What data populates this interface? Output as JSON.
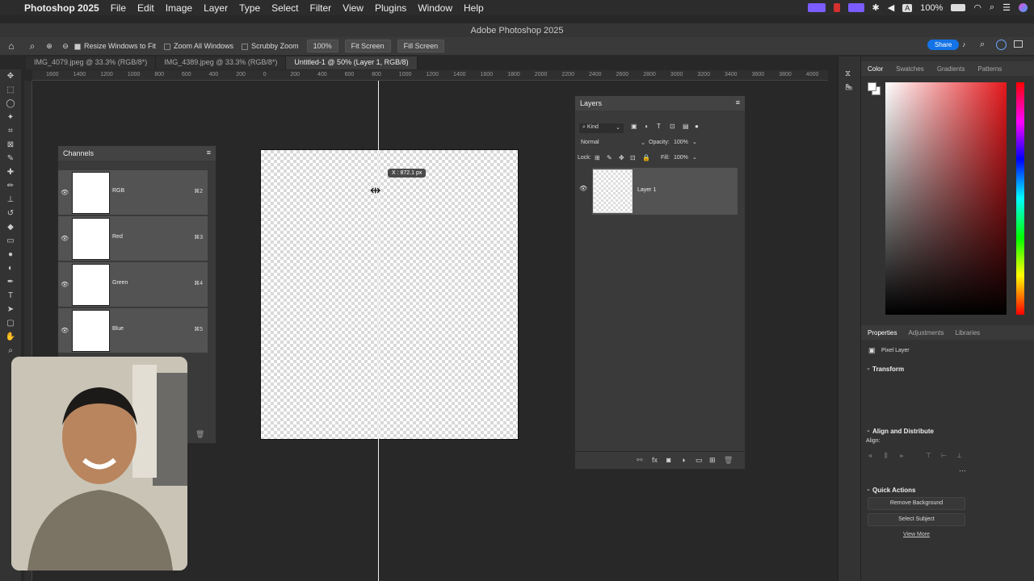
{
  "menubar": {
    "app_name": "Photoshop 2025",
    "items": [
      "File",
      "Edit",
      "Image",
      "Layer",
      "Type",
      "Select",
      "Filter",
      "View",
      "Plugins",
      "Window",
      "Help"
    ],
    "battery": "100%"
  },
  "window": {
    "title": "Adobe Photoshop 2025"
  },
  "options": {
    "resize_windows": "Resize Windows to Fit",
    "zoom_all": "Zoom All Windows",
    "scrubby_zoom": "Scrubby Zoom",
    "zoom_value": "100%",
    "fit_screen": "Fit Screen",
    "fill_screen": "Fill Screen",
    "share": "Share"
  },
  "tabs": [
    "IMG_4079.jpeg @ 33.3% (RGB/8*)",
    "IMG_4389.jpeg @ 33.3% (RGB/8*)",
    "Untitled-1 @ 50% (Layer 1, RGB/8)"
  ],
  "ruler_ticks": [
    "1600",
    "1400",
    "1200",
    "1000",
    "800",
    "600",
    "400",
    "200",
    "0",
    "200",
    "400",
    "600",
    "800",
    "1000",
    "1200",
    "1400",
    "1600",
    "1800",
    "2000",
    "2200",
    "2400",
    "2600",
    "2800",
    "3000",
    "3200",
    "3400",
    "3600",
    "3800",
    "4000"
  ],
  "canvas": {
    "tooltip": "X : 872.1 px"
  },
  "channels": {
    "title": "Channels",
    "rows": [
      {
        "name": "RGB",
        "shortcut": "⌘2"
      },
      {
        "name": "Red",
        "shortcut": "⌘3"
      },
      {
        "name": "Green",
        "shortcut": "⌘4"
      },
      {
        "name": "Blue",
        "shortcut": "⌘5"
      }
    ]
  },
  "layers": {
    "title": "Layers",
    "filter": "Kind",
    "blend_mode": "Normal",
    "opacity_label": "Opacity:",
    "opacity": "100%",
    "lock_label": "Lock:",
    "fill_label": "Fill:",
    "fill": "100%",
    "layer_name": "Layer 1"
  },
  "color_tabs": [
    "Color",
    "Swatches",
    "Gradients",
    "Patterns"
  ],
  "props_tabs": [
    "Properties",
    "Adjustments",
    "Libraries"
  ],
  "properties": {
    "kind": "Pixel Layer",
    "transform": "Transform",
    "align": "Align and Distribute",
    "align_label": "Align:",
    "quick_actions": "Quick Actions",
    "remove_bg": "Remove Background",
    "select_subject": "Select Subject",
    "view_more": "View More"
  },
  "colors": {
    "accent": "#1473e6",
    "hue_red": "#e4181c"
  }
}
